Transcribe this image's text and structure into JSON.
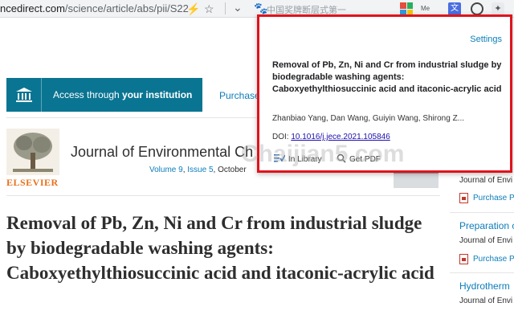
{
  "browser": {
    "url_host": "ncedirect.com",
    "url_path": "/science/article/abs/pii/S22",
    "bolt_icon": "⚡",
    "star_icon": "☆",
    "chevron_icon": "⌄",
    "paw_icon": "🐾",
    "ext_search_text": "中国奖牌断层式第一",
    "ext_meta_label": "Me",
    "ext_trans_label": "文"
  },
  "page": {
    "institution_access": {
      "prefix": "Access through ",
      "bold": "your institution"
    },
    "purchase_label": "Purchase",
    "publisher_logo_text": "ELSEVIER",
    "journal_title": "Journal of Environmental Ch",
    "volume_text": "Volume 9",
    "issue_text": "Issue 5",
    "date_text": ", October",
    "article_title": "Removal of Pb, Zn, Ni and Cr from industrial sludge by biodegradable washing agents: Caboxyethylthiosuccinic acid and itaconic-acrylic acid"
  },
  "rail": [
    {
      "journal": "Journal of Envi",
      "pdf_label": "Purchase P"
    },
    {
      "title": "Preparation c",
      "journal": "Journal of Envi",
      "pdf_label": "Purchase P"
    },
    {
      "title": "Hydrotherm",
      "journal": "Journal of Envi"
    }
  ],
  "popup": {
    "settings_label": "Settings",
    "title": "Removal of Pb, Zn, Ni and Cr from industrial sludge by biodegradable washing agents: Caboxyethylthiosuccinic acid and itaconic-acrylic acid",
    "authors": "Zhanbiao Yang, Dan Wang, Guiyin Wang, Shirong Z...",
    "doi_label": "DOI: ",
    "doi_value": "10.1016/j.jece.2021.105846",
    "in_library_label": "In Library",
    "get_pdf_label": "Get PDF"
  },
  "watermark": "Chaijian5.com",
  "colors": {
    "accent_teal": "#0a7592",
    "link_blue": "#0c7dbb",
    "elsevier_orange": "#e9711c",
    "popup_border": "#e0131c"
  }
}
